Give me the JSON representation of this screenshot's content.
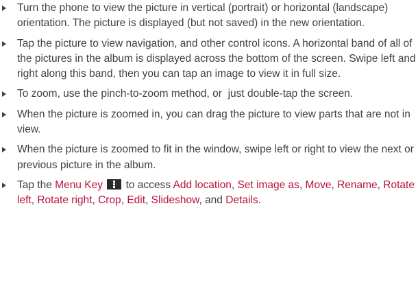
{
  "bullets": [
    {
      "text": "Turn the phone to view the picture in vertical (portrait) or horizontal (landscape) orientation. The picture is displayed (but not saved) in the new orientation."
    },
    {
      "text": "Tap the picture to view navigation, and other control icons. A horizontal band of all of the pictures in the album is displayed across the bottom of the screen. Swipe left and right along this band, then you can tap an image to view it in full size."
    },
    {
      "text": "To zoom, use the pinch-to-zoom method, or  just double-tap the screen."
    },
    {
      "text": "When the picture is zoomed in, you can drag the picture to view parts that are not in view."
    },
    {
      "text": "When the picture is zoomed to fit in the window, swipe left or right to view the next or previous picture in the album."
    }
  ],
  "menu_bullet": {
    "intro": "Tap the ",
    "menu_key": "Menu Key",
    "menu_key_icon": "menu-key-icon",
    "to_access": " to access ",
    "options": [
      "Add location",
      "Set image as",
      "Move",
      "Rename",
      "Rotate left",
      "Rotate right",
      "Crop",
      "Edit",
      "Slideshow"
    ],
    "sep": ", ",
    "and": ", and ",
    "last_option": "Details",
    "end": "."
  },
  "colors": {
    "body_text": "#404040",
    "highlight": "#b8123a",
    "icon_bg": "#2a2a2a"
  }
}
